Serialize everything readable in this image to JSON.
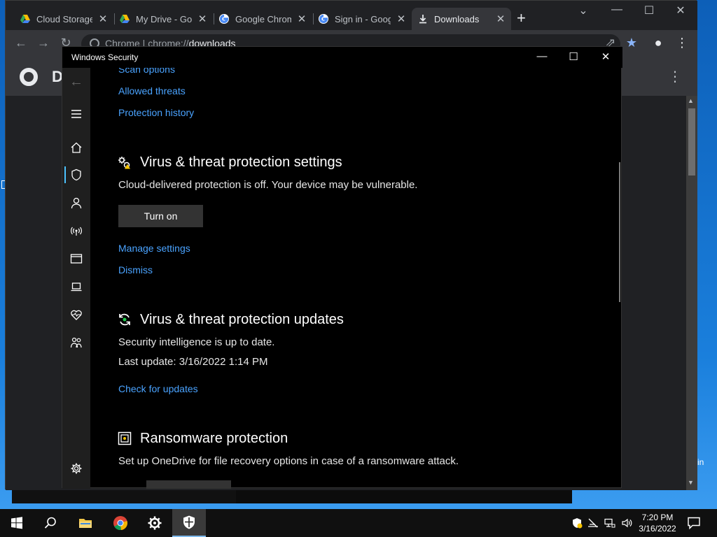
{
  "chrome": {
    "tabs": [
      {
        "label": "Cloud Storage",
        "favicon": "google-drive-icon"
      },
      {
        "label": "My Drive - Goo",
        "favicon": "google-drive-icon"
      },
      {
        "label": "Google Chrom",
        "favicon": "google-icon"
      },
      {
        "label": "Sign in - Goog",
        "favicon": "google-icon"
      },
      {
        "label": "Downloads",
        "favicon": "download-icon",
        "active": true
      }
    ],
    "new_tab": "+",
    "close_glyph": "✕",
    "omnibox": {
      "scheme_label": "Chrome",
      "separator": " | ",
      "url_prefix": "chrome://",
      "url_host": "downloads"
    },
    "page_title_initial": "D",
    "more_glyph": "⋮"
  },
  "winsec": {
    "title": "Windows Security",
    "controls": {
      "minimize": "—",
      "maximize": "☐",
      "close": "✕"
    },
    "back_glyph": "←",
    "top_links": [
      "Scan options",
      "Allowed threats",
      "Protection history"
    ],
    "settings_section": {
      "title": "Virus & threat protection settings",
      "body": "Cloud-delivered protection is off. Your device may be vulnerable.",
      "button": "Turn on",
      "links": [
        "Manage settings",
        "Dismiss"
      ]
    },
    "updates_section": {
      "title": "Virus & threat protection updates",
      "status": "Security intelligence is up to date.",
      "last_update": "Last update: 3/16/2022 1:14 PM",
      "link": "Check for updates"
    },
    "ransomware_section": {
      "title": "Ransomware protection",
      "body": "Set up OneDrive for file recovery options in case of a ransomware attack."
    },
    "nav_icons": [
      "hamburger-icon",
      "home-icon",
      "shield-icon",
      "person-icon",
      "wireless-icon",
      "app-browser-icon",
      "laptop-icon",
      "heart-icon",
      "family-icon",
      "gear-icon"
    ]
  },
  "desktop": {
    "peek_text": "in"
  },
  "taskbar": {
    "items": [
      "start-icon",
      "search-icon",
      "file-explorer-icon",
      "chrome-icon",
      "settings-icon",
      "windows-security-icon"
    ],
    "clock_time": "7:20 PM",
    "clock_date": "3/16/2022",
    "tray_icons": [
      "security-tray-icon",
      "network-disconnected-icon",
      "network-icon",
      "volume-icon"
    ]
  },
  "colors": {
    "link": "#4aa3ff",
    "accent": "#4cc2ff",
    "button": "#333333"
  }
}
